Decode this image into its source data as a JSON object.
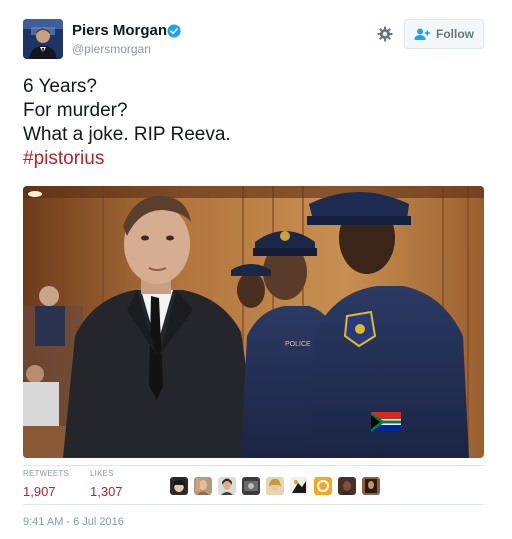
{
  "author": {
    "name": "Piers Morgan",
    "handle": "@piersmorgan",
    "verified": true
  },
  "actions": {
    "follow_label": "Follow",
    "settings_icon": "gear-icon",
    "follow_icon": "person-plus-icon"
  },
  "tweet": {
    "lines": [
      "6 Years?",
      "For murder?",
      "What a joke. RIP Reeva."
    ],
    "hashtag": "#pistorius"
  },
  "stats": {
    "retweets_label": "RETWEETS",
    "retweets_value": "1,907",
    "likes_label": "LIKES",
    "likes_value": "1,307"
  },
  "likers_count": 9,
  "timestamp": "9:41 AM - 6 Jul 2016",
  "colors": {
    "accent": "#b4232a",
    "muted": "#8899a6",
    "border": "#e1e8ed",
    "verified": "#1da1f2"
  }
}
